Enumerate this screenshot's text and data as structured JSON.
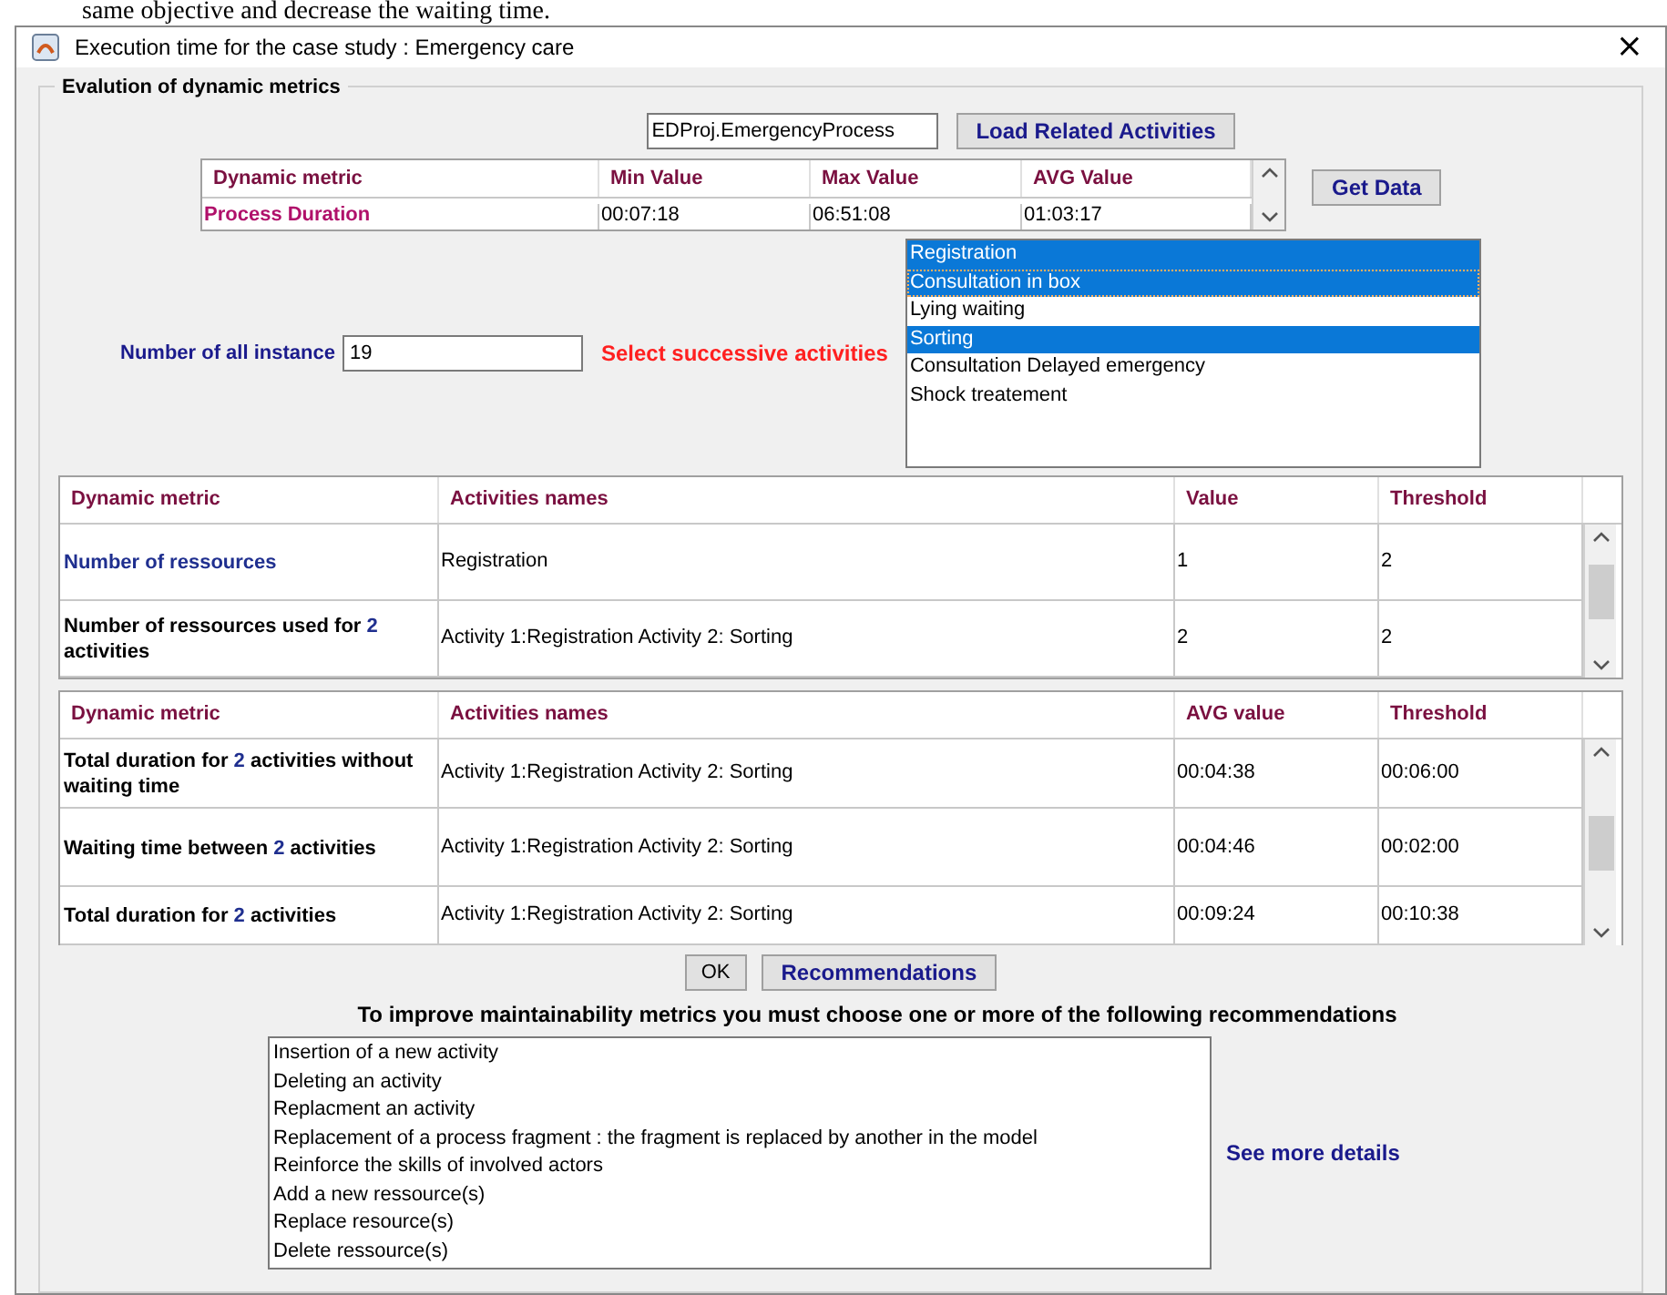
{
  "document_text": "same objective and decrease the waiting time.",
  "window": {
    "title": "Execution time for the case study : Emergency care",
    "close": "×"
  },
  "group": {
    "title": "Evalution of dynamic metrics"
  },
  "process_field": {
    "value": "EDProj.EmergencyProcess"
  },
  "load_button": "Load Related Activities",
  "summary_table": {
    "columns": [
      "Dynamic metric",
      "Min Value",
      "Max Value",
      "AVG Value"
    ],
    "rows": [
      {
        "cells": [
          "Process Duration",
          "00:07:18",
          "06:51:08",
          "01:03:17"
        ]
      }
    ]
  },
  "get_data_button": "Get Data",
  "instances": {
    "label": "Number of all instance",
    "value": "19"
  },
  "select_label": "Select successive activities",
  "activities": [
    {
      "label": "Registration",
      "selected": true,
      "focused": false
    },
    {
      "label": "Consultation in box",
      "selected": true,
      "focused": true
    },
    {
      "label": "Lying waiting",
      "selected": false,
      "focused": false
    },
    {
      "label": "Sorting",
      "selected": true,
      "focused": false
    },
    {
      "label": "Consultation Delayed emergency",
      "selected": false,
      "focused": false
    },
    {
      "label": "Shock treatement",
      "selected": false,
      "focused": false
    }
  ],
  "resources_table": {
    "columns": [
      "Dynamic metric",
      "Activities names",
      "Value",
      "Threshold"
    ],
    "rows": [
      {
        "cells": [
          {
            "parts": [
              {
                "text": "Number of ressources",
                "accent": true
              }
            ]
          },
          "Registration",
          "1",
          "2"
        ]
      },
      {
        "cells": [
          {
            "parts": [
              {
                "text": "Number of ressources used for ",
                "accent": false
              },
              {
                "text": "2",
                "accent": true
              },
              {
                "text": " activities",
                "accent": false
              }
            ]
          },
          "Activity 1:Registration Activity 2: Sorting",
          "2",
          "2"
        ]
      }
    ]
  },
  "duration_table": {
    "columns": [
      "Dynamic metric",
      "Activities names",
      "AVG value",
      "Threshold"
    ],
    "rows": [
      {
        "cells": [
          {
            "parts": [
              {
                "text": "Total duration for ",
                "accent": false
              },
              {
                "text": "2",
                "accent": true
              },
              {
                "text": " activities without waiting time",
                "accent": false
              }
            ]
          },
          "Activity 1:Registration Activity 2: Sorting",
          "00:04:38",
          "00:06:00"
        ]
      },
      {
        "cells": [
          {
            "parts": [
              {
                "text": "Waiting time between ",
                "accent": false
              },
              {
                "text": "2",
                "accent": true
              },
              {
                "text": " activities",
                "accent": false
              }
            ]
          },
          "Activity 1:Registration Activity 2: Sorting",
          "00:04:46",
          "00:02:00"
        ]
      },
      {
        "cells": [
          {
            "parts": [
              {
                "text": "Total duration for ",
                "accent": false
              },
              {
                "text": "2",
                "accent": true
              },
              {
                "text": " activities",
                "accent": false
              }
            ]
          },
          "Activity 1:Registration Activity 2: Sorting",
          "00:09:24",
          "00:10:38"
        ]
      }
    ]
  },
  "ok_button": "OK",
  "recommendations_button": "Recommendations",
  "recommendation_prompt": "To improve maintainability metrics you must choose one or more of the following recommendations",
  "recommendations": [
    "Insertion of a new activity",
    "Deleting an activity",
    "Replacment an activity",
    "Replacement of a process fragment : the fragment is replaced by another in the model",
    "Reinforce the skills of involved actors",
    "Add a new ressource(s)",
    "Replace resource(s)",
    "Delete ressource(s)"
  ],
  "details_link": "See more details"
}
